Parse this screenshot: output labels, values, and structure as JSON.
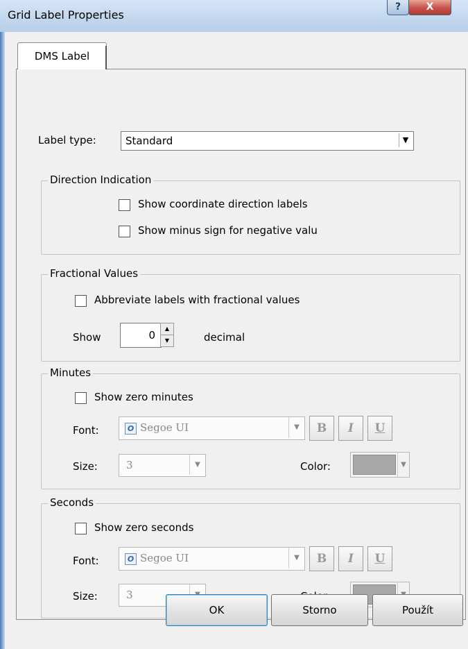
{
  "window": {
    "title": "Grid Label Properties",
    "help_glyph": "?",
    "close_glyph": "X"
  },
  "tab": {
    "label": "DMS Label"
  },
  "label_type": {
    "label": "Label type:",
    "value": "Standard",
    "arrow": "▼"
  },
  "direction": {
    "title": "Direction Indication",
    "show_coordinate_labels": "Show coordinate direction labels",
    "show_minus_sign": "Show minus sign for negative valu"
  },
  "fractional": {
    "title": "Fractional Values",
    "abbreviate": "Abbreviate labels with fractional values",
    "show_label": "Show",
    "decimal_value": "0",
    "decimal_label": "decimal",
    "up": "▲",
    "down": "▼"
  },
  "minutes": {
    "title": "Minutes",
    "show_zero": "Show zero minutes",
    "font_label": "Font:",
    "font_value": "Segoe UI",
    "size_label": "Size:",
    "size_value": "3",
    "color_label": "Color:"
  },
  "seconds": {
    "title": "Seconds",
    "show_zero": "Show zero seconds",
    "font_label": "Font:",
    "font_value": "Segoe UI",
    "size_label": "Size:",
    "size_value": "3",
    "color_label": "Color:"
  },
  "format_buttons": {
    "bold": "B",
    "italic": "I",
    "underline": "U"
  },
  "font_icon": "O",
  "arrow": "▼",
  "buttons": {
    "ok": "OK",
    "cancel": "Storno",
    "apply": "Použít"
  },
  "colors": {
    "color_swatch": "#a8a8a8",
    "title_bar": "#c3d8ee"
  }
}
